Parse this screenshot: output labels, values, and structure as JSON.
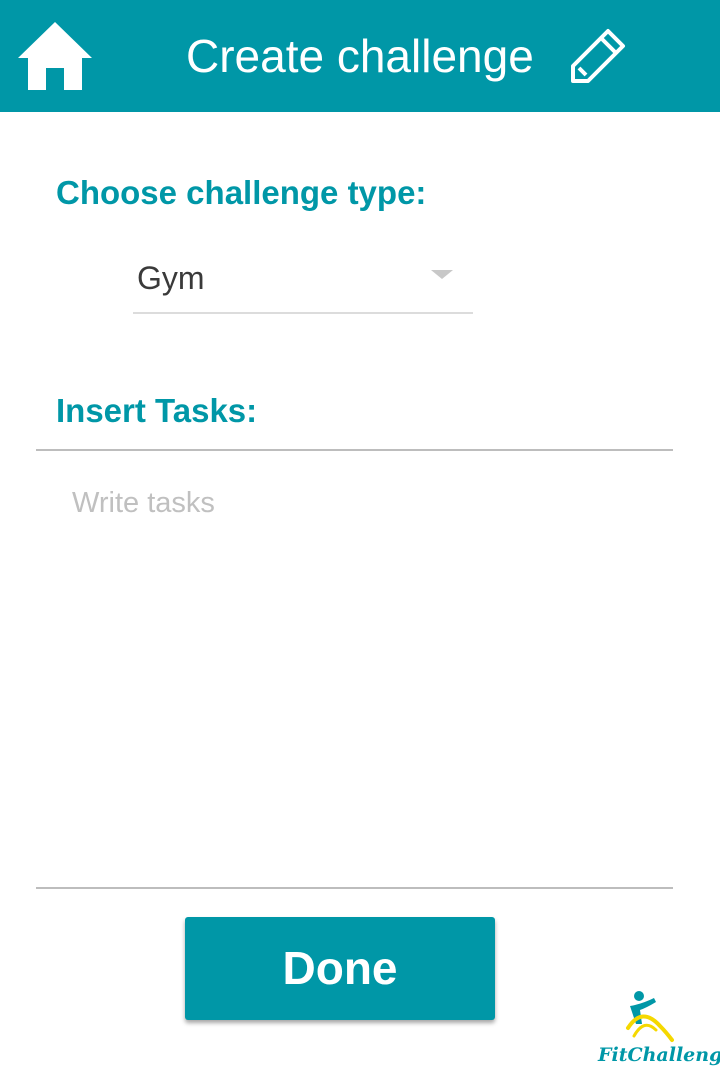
{
  "header": {
    "title": "Create challenge",
    "home_icon": "home-icon",
    "edit_icon": "pencil-icon",
    "background_color": "#0097a7"
  },
  "challenge_type": {
    "label": "Choose challenge type:",
    "selected": "Gym"
  },
  "tasks": {
    "label": "Insert Tasks:",
    "placeholder": "Write tasks",
    "value": ""
  },
  "done_button": {
    "label": "Done"
  },
  "logo": {
    "text": "FitChallenger"
  },
  "colors": {
    "accent": "#0097a7",
    "logo_yellow": "#f5d800"
  }
}
